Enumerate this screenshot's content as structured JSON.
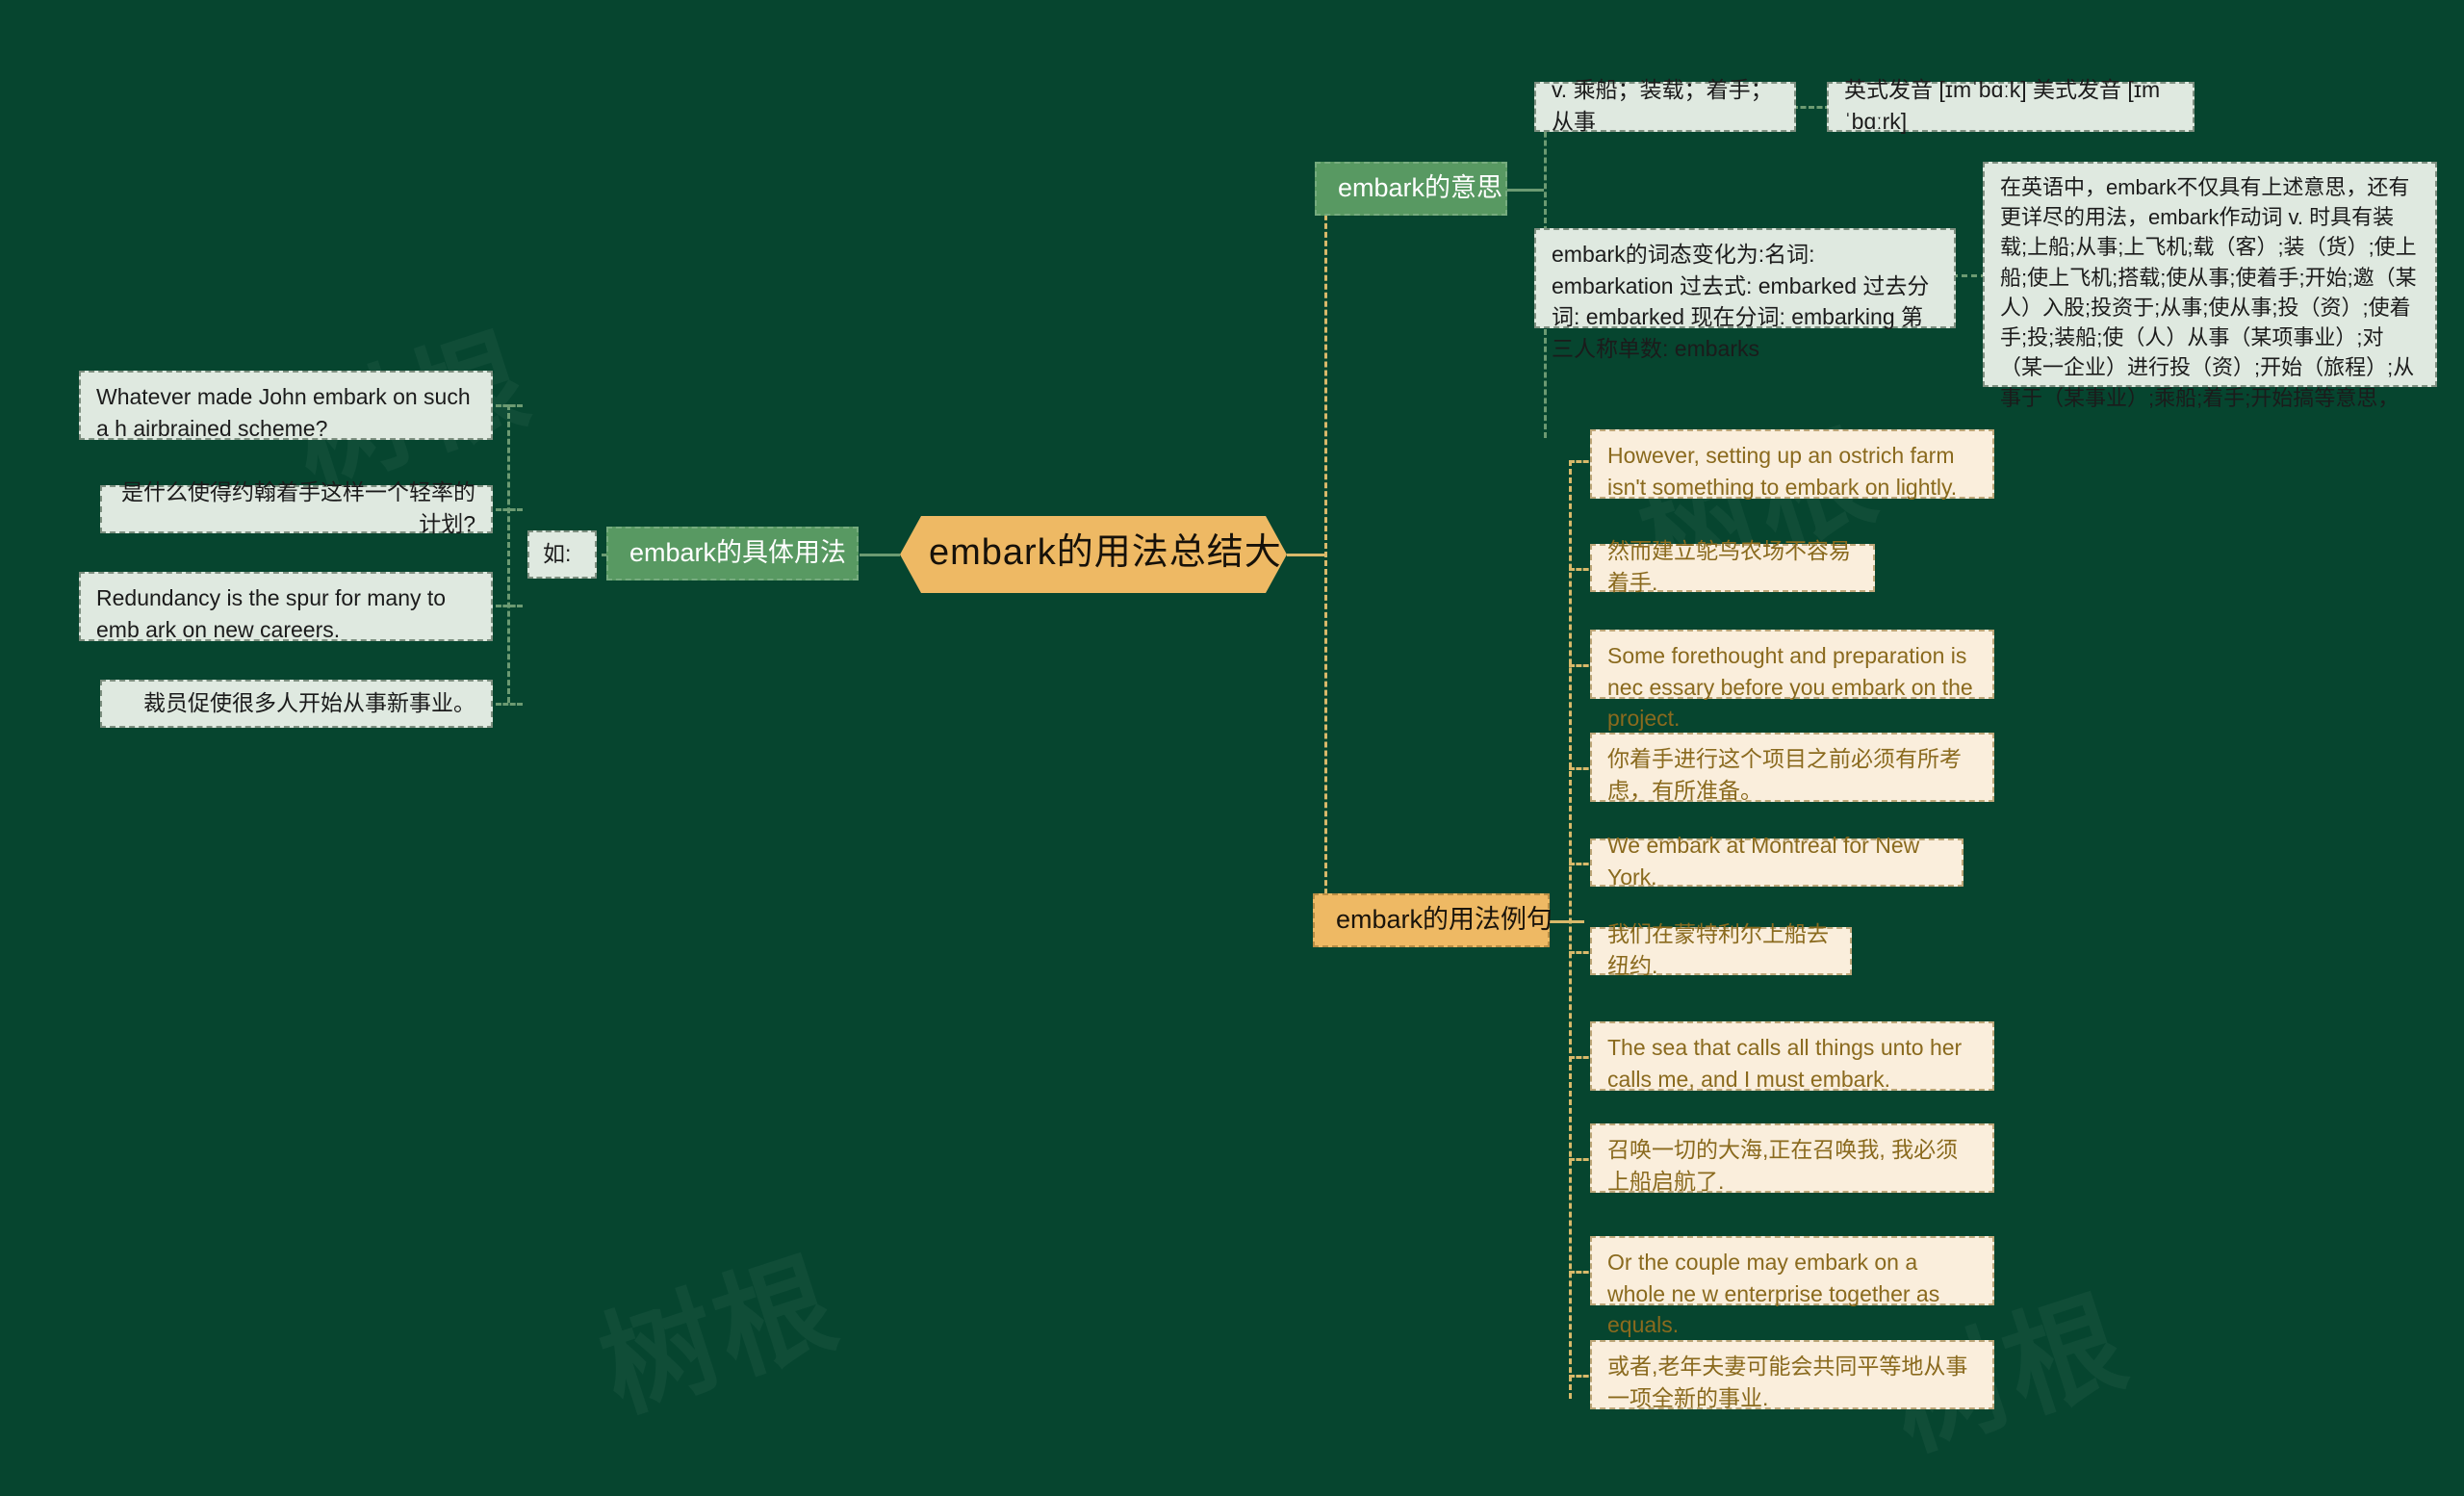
{
  "theme": {
    "background": "#06452f",
    "root_fill": "#eeb964",
    "branch_green_fill": "#589962",
    "branch_gold_fill": "#eeb964",
    "leaf_mint_fill": "#dfe9e0",
    "leaf_cream_fill": "#faeedc",
    "leaf_cream_text": "#8a6a1e",
    "connector_green": "#6c9a72",
    "connector_gold": "#d9b96a"
  },
  "root": {
    "label": "embark的用法总结大全"
  },
  "branches": {
    "meaning": {
      "label": "embark的意思",
      "children": [
        {
          "label": "v. 乘船；装载；着手；从事"
        },
        {
          "label": "英式发音 [ɪmˈbɑːk] 美式发音 [ɪmˈbɑːrk]"
        },
        {
          "label": "embark的词态变化为:名词: embarkation 过去式: embarked 过去分词: embarked 现在分词: embarking 第三人称单数: embarks"
        },
        {
          "label": "在英语中，embark不仅具有上述意思，还有更详尽的用法，embark作动词 v. 时具有装载;上船;从事;上飞机;载（客）;装（货）;使上船;使上飞机;搭载;使从事;使着手;开始;邀（某人）入股;投资于;从事;使从事;投（资）;使着手;投;装船;使（人）从事（某项事业）;对（某一企业）进行投（资）;开始（旅程）;从事于（某事业）;乘船;着手;开始搞等意思，"
        }
      ]
    },
    "usage": {
      "label": "embark的具体用法",
      "connector_label": "如:",
      "children": [
        {
          "label": "Whatever made John embark on such a h airbrained scheme?",
          "align": "left"
        },
        {
          "label": "是什么使得约翰着手这样一个轻率的计划?",
          "align": "right"
        },
        {
          "label": "Redundancy is the spur for many to emb ark on new careers.",
          "align": "left"
        },
        {
          "label": "裁员促使很多人开始从事新事业。",
          "align": "right"
        }
      ]
    },
    "examples": {
      "label": "embark的用法例句",
      "children": [
        {
          "label": "However, setting up an ostrich farm isn't something to embark on lightly."
        },
        {
          "label": "然而建立鸵鸟农场不容易着手."
        },
        {
          "label": "Some forethought and preparation is nec essary before you embark on the project."
        },
        {
          "label": "你着手进行这个项目之前必须有所考虑，有所准备。"
        },
        {
          "label": "We embark at Montreal for New York."
        },
        {
          "label": "我们在蒙特利尔上船去纽约."
        },
        {
          "label": "The sea that calls all things unto her calls me, and I must embark."
        },
        {
          "label": "召唤一切的大海,正在召唤我, 我必须上船启航了."
        },
        {
          "label": "Or the couple may embark on a whole ne w enterprise together as equals."
        },
        {
          "label": "或者,老年夫妻可能会共同平等地从事一项全新的事业."
        }
      ]
    }
  },
  "watermarks": [
    {
      "text": "树根"
    },
    {
      "text": "树根"
    },
    {
      "text": "树根"
    },
    {
      "text": "树根"
    }
  ]
}
